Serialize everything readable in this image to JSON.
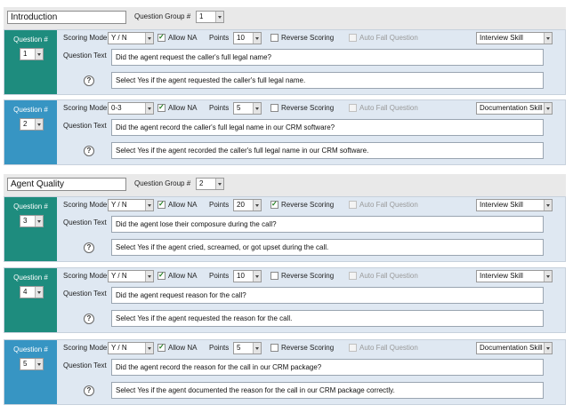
{
  "labels": {
    "question_group": "Question Group #",
    "question": "Question #",
    "scoring_mode": "Scoring Mode",
    "allow_na": "Allow NA",
    "points": "Points",
    "reverse_scoring": "Reverse Scoring",
    "auto_fail": "Auto Fall Question",
    "question_text": "Question Text",
    "help": "?"
  },
  "groups": [
    {
      "name": "Introduction",
      "number": "1",
      "questions": [
        {
          "number": "1",
          "scoring_mode": "Y / N",
          "allow_na": true,
          "points": "10",
          "reverse_scoring": false,
          "auto_fail": false,
          "category": "Interview Skill",
          "text": "Did the agent request the caller's full legal name?",
          "help": "Select Yes if the agent requested the caller's full legal name.",
          "color": "#1e8c7e"
        },
        {
          "number": "2",
          "scoring_mode": "0-3",
          "allow_na": true,
          "points": "5",
          "reverse_scoring": false,
          "auto_fail": false,
          "category": "Documentation Skill",
          "text": "Did the agent record the caller's full legal name in our CRM software?",
          "help": "Select Yes if the agent recorded the caller's full legal name in our CRM software.",
          "color": "#3795c3"
        }
      ]
    },
    {
      "name": "Agent Quality",
      "number": "2",
      "questions": [
        {
          "number": "3",
          "scoring_mode": "Y / N",
          "allow_na": true,
          "points": "20",
          "reverse_scoring": true,
          "auto_fail": false,
          "category": "Interview Skill",
          "text": "Did the agent lose their composure during the call?",
          "help": "Select Yes if the agent cried, screamed, or got upset during the call.",
          "color": "#1e8c7e"
        },
        {
          "number": "4",
          "scoring_mode": "Y / N",
          "allow_na": true,
          "points": "10",
          "reverse_scoring": false,
          "auto_fail": false,
          "category": "Interview Skill",
          "text": "Did the agent request reason for the call?",
          "help": "Select Yes if the agent requested the reason for the call.",
          "color": "#1e8c7e"
        },
        {
          "number": "5",
          "scoring_mode": "Y / N",
          "allow_na": true,
          "points": "5",
          "reverse_scoring": false,
          "auto_fail": false,
          "category": "Documentation Skill",
          "text": "Did the agent record the reason for the call in our CRM package?",
          "help": "Select Yes if the agent documented the reason for the call in our CRM package correctly.",
          "color": "#3795c3"
        }
      ]
    }
  ]
}
